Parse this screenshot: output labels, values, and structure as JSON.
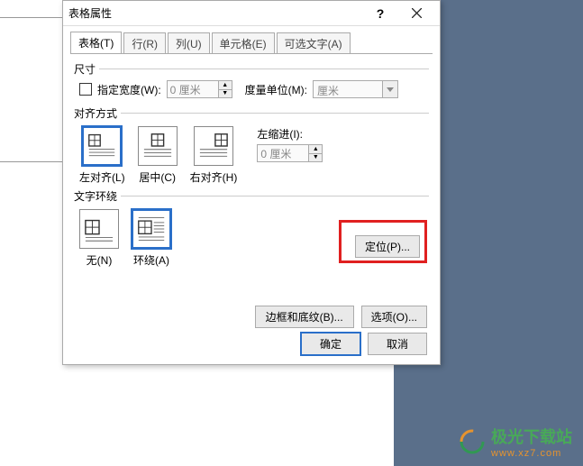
{
  "dialog": {
    "title": "表格属性",
    "help_symbol": "?",
    "tabs": [
      {
        "label": "表格(T)",
        "active": true
      },
      {
        "label": "行(R)",
        "active": false
      },
      {
        "label": "列(U)",
        "active": false
      },
      {
        "label": "单元格(E)",
        "active": false
      },
      {
        "label": "可选文字(A)",
        "active": false
      }
    ],
    "size": {
      "group_label": "尺寸",
      "pref_width_label": "指定宽度(W):",
      "pref_width_value": "0 厘米",
      "measure_label": "度量单位(M):",
      "measure_value": "厘米"
    },
    "alignment": {
      "group_label": "对齐方式",
      "left": "左对齐(L)",
      "center": "居中(C)",
      "right": "右对齐(H)",
      "indent_label": "左缩进(I):",
      "indent_value": "0 厘米"
    },
    "wrap": {
      "group_label": "文字环绕",
      "none": "无(N)",
      "around": "环绕(A)",
      "positioning_btn": "定位(P)..."
    },
    "bottom": {
      "borders_btn": "边框和底纹(B)...",
      "options_btn": "选项(O)..."
    },
    "actions": {
      "ok": "确定",
      "cancel": "取消"
    }
  },
  "watermark": {
    "text": "极光下载站",
    "sub": "www.xz7.com"
  }
}
